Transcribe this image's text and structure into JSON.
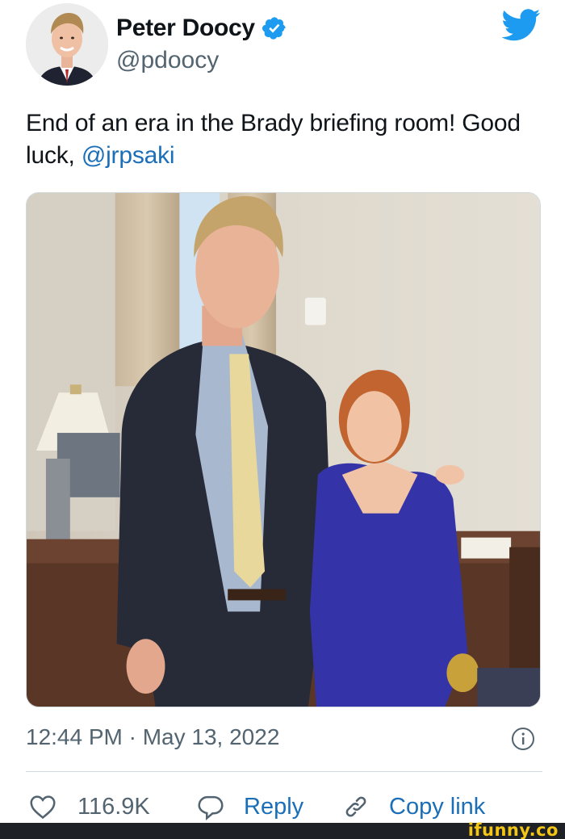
{
  "author": {
    "display_name": "Peter Doocy",
    "handle": "@pdoocy",
    "verified": true,
    "avatar_icon": "avatar-photo"
  },
  "tweet": {
    "text_before_mention": "End of an era in the Brady briefing room! Good luck, ",
    "mention": "@jrpsaki",
    "timestamp": "12:44 PM · May 13, 2022"
  },
  "actions": {
    "like_count": "116.9K",
    "reply_label": "Reply",
    "copy_label": "Copy link"
  },
  "watermark": "ifunny.co",
  "colors": {
    "twitter_blue": "#1d9bf0",
    "link_blue": "#1b6fb8",
    "secondary_text": "#536471",
    "divider": "#cfd9de"
  },
  "icons": [
    "twitter-bird-icon",
    "verified-badge-icon",
    "info-icon",
    "heart-icon",
    "reply-bubble-icon",
    "link-icon"
  ]
}
